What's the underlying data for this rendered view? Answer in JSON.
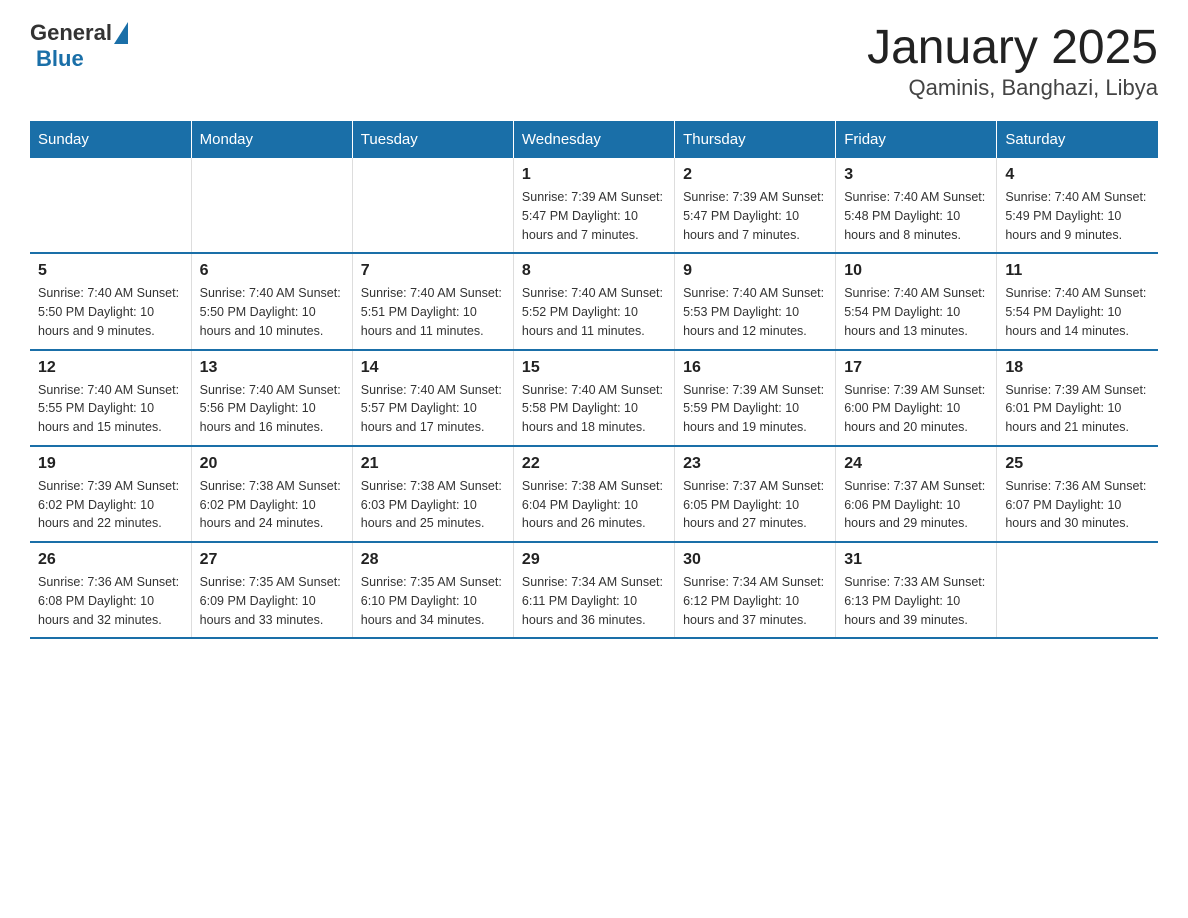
{
  "logo": {
    "general": "General",
    "blue": "Blue"
  },
  "title": "January 2025",
  "subtitle": "Qaminis, Banghazi, Libya",
  "days_of_week": [
    "Sunday",
    "Monday",
    "Tuesday",
    "Wednesday",
    "Thursday",
    "Friday",
    "Saturday"
  ],
  "weeks": [
    [
      {
        "day": "",
        "info": ""
      },
      {
        "day": "",
        "info": ""
      },
      {
        "day": "",
        "info": ""
      },
      {
        "day": "1",
        "info": "Sunrise: 7:39 AM\nSunset: 5:47 PM\nDaylight: 10 hours and 7 minutes."
      },
      {
        "day": "2",
        "info": "Sunrise: 7:39 AM\nSunset: 5:47 PM\nDaylight: 10 hours and 7 minutes."
      },
      {
        "day": "3",
        "info": "Sunrise: 7:40 AM\nSunset: 5:48 PM\nDaylight: 10 hours and 8 minutes."
      },
      {
        "day": "4",
        "info": "Sunrise: 7:40 AM\nSunset: 5:49 PM\nDaylight: 10 hours and 9 minutes."
      }
    ],
    [
      {
        "day": "5",
        "info": "Sunrise: 7:40 AM\nSunset: 5:50 PM\nDaylight: 10 hours and 9 minutes."
      },
      {
        "day": "6",
        "info": "Sunrise: 7:40 AM\nSunset: 5:50 PM\nDaylight: 10 hours and 10 minutes."
      },
      {
        "day": "7",
        "info": "Sunrise: 7:40 AM\nSunset: 5:51 PM\nDaylight: 10 hours and 11 minutes."
      },
      {
        "day": "8",
        "info": "Sunrise: 7:40 AM\nSunset: 5:52 PM\nDaylight: 10 hours and 11 minutes."
      },
      {
        "day": "9",
        "info": "Sunrise: 7:40 AM\nSunset: 5:53 PM\nDaylight: 10 hours and 12 minutes."
      },
      {
        "day": "10",
        "info": "Sunrise: 7:40 AM\nSunset: 5:54 PM\nDaylight: 10 hours and 13 minutes."
      },
      {
        "day": "11",
        "info": "Sunrise: 7:40 AM\nSunset: 5:54 PM\nDaylight: 10 hours and 14 minutes."
      }
    ],
    [
      {
        "day": "12",
        "info": "Sunrise: 7:40 AM\nSunset: 5:55 PM\nDaylight: 10 hours and 15 minutes."
      },
      {
        "day": "13",
        "info": "Sunrise: 7:40 AM\nSunset: 5:56 PM\nDaylight: 10 hours and 16 minutes."
      },
      {
        "day": "14",
        "info": "Sunrise: 7:40 AM\nSunset: 5:57 PM\nDaylight: 10 hours and 17 minutes."
      },
      {
        "day": "15",
        "info": "Sunrise: 7:40 AM\nSunset: 5:58 PM\nDaylight: 10 hours and 18 minutes."
      },
      {
        "day": "16",
        "info": "Sunrise: 7:39 AM\nSunset: 5:59 PM\nDaylight: 10 hours and 19 minutes."
      },
      {
        "day": "17",
        "info": "Sunrise: 7:39 AM\nSunset: 6:00 PM\nDaylight: 10 hours and 20 minutes."
      },
      {
        "day": "18",
        "info": "Sunrise: 7:39 AM\nSunset: 6:01 PM\nDaylight: 10 hours and 21 minutes."
      }
    ],
    [
      {
        "day": "19",
        "info": "Sunrise: 7:39 AM\nSunset: 6:02 PM\nDaylight: 10 hours and 22 minutes."
      },
      {
        "day": "20",
        "info": "Sunrise: 7:38 AM\nSunset: 6:02 PM\nDaylight: 10 hours and 24 minutes."
      },
      {
        "day": "21",
        "info": "Sunrise: 7:38 AM\nSunset: 6:03 PM\nDaylight: 10 hours and 25 minutes."
      },
      {
        "day": "22",
        "info": "Sunrise: 7:38 AM\nSunset: 6:04 PM\nDaylight: 10 hours and 26 minutes."
      },
      {
        "day": "23",
        "info": "Sunrise: 7:37 AM\nSunset: 6:05 PM\nDaylight: 10 hours and 27 minutes."
      },
      {
        "day": "24",
        "info": "Sunrise: 7:37 AM\nSunset: 6:06 PM\nDaylight: 10 hours and 29 minutes."
      },
      {
        "day": "25",
        "info": "Sunrise: 7:36 AM\nSunset: 6:07 PM\nDaylight: 10 hours and 30 minutes."
      }
    ],
    [
      {
        "day": "26",
        "info": "Sunrise: 7:36 AM\nSunset: 6:08 PM\nDaylight: 10 hours and 32 minutes."
      },
      {
        "day": "27",
        "info": "Sunrise: 7:35 AM\nSunset: 6:09 PM\nDaylight: 10 hours and 33 minutes."
      },
      {
        "day": "28",
        "info": "Sunrise: 7:35 AM\nSunset: 6:10 PM\nDaylight: 10 hours and 34 minutes."
      },
      {
        "day": "29",
        "info": "Sunrise: 7:34 AM\nSunset: 6:11 PM\nDaylight: 10 hours and 36 minutes."
      },
      {
        "day": "30",
        "info": "Sunrise: 7:34 AM\nSunset: 6:12 PM\nDaylight: 10 hours and 37 minutes."
      },
      {
        "day": "31",
        "info": "Sunrise: 7:33 AM\nSunset: 6:13 PM\nDaylight: 10 hours and 39 minutes."
      },
      {
        "day": "",
        "info": ""
      }
    ]
  ]
}
